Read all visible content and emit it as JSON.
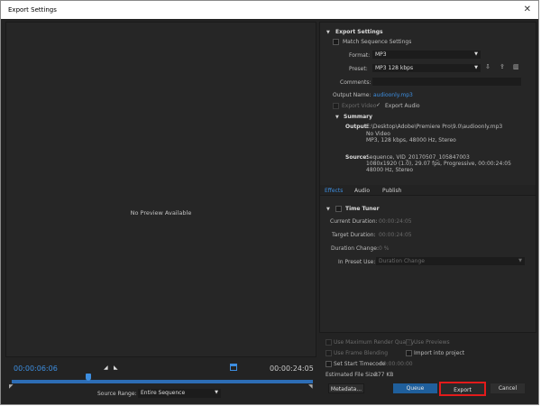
{
  "window": {
    "title": "Export Settings",
    "close_icon": "close-icon"
  },
  "preview": {
    "no_preview_text": "No Preview Available",
    "current_time": "00:00:06:06",
    "end_time": "00:00:24:05",
    "source_range_label": "Source Range:",
    "source_range_value": "Entire Sequence"
  },
  "export_settings": {
    "header": "Export Settings",
    "match_sequence_label": "Match Sequence Settings",
    "format_label": "Format:",
    "format_value": "MP3",
    "preset_label": "Preset:",
    "preset_value": "MP3 128 kbps",
    "comments_label": "Comments:",
    "output_name_label": "Output Name:",
    "output_name_value": "audioonly.mp3",
    "export_video_label": "Export Video",
    "export_audio_label": "Export Audio",
    "export_audio_check": "✓"
  },
  "summary": {
    "header": "Summary",
    "output_label": "Output:",
    "output_lines": [
      "E:\\Desktop\\Adobe\\Premiere Pro\\9.0\\audioonly.mp3",
      "No Video",
      "MP3, 128 kbps, 48000 Hz, Stereo"
    ],
    "source_label": "Source:",
    "source_lines": [
      "Sequence, VID_20170507_105847003",
      "1080x1920 (1.0), 29.07 fps, Progressive, 00:00:24:05",
      "48000 Hz, Stereo"
    ]
  },
  "tabs": [
    {
      "label": "Effects"
    },
    {
      "label": "Audio"
    },
    {
      "label": "Publish"
    }
  ],
  "time_tuner": {
    "header": "Time Tuner",
    "current_duration_label": "Current Duration:",
    "current_duration_value": "00:00:24:05",
    "target_duration_label": "Target Duration:",
    "target_duration_value": "00:00:24:05",
    "duration_change_label": "Duration Change:",
    "duration_change_value": "0 %",
    "in_preset_use_label": "In Preset Use:",
    "in_preset_use_value": "Duration Change"
  },
  "bottom": {
    "use_max_render_quality": "Use Maximum Render Quality",
    "use_previews": "Use Previews",
    "use_frame_blending": "Use Frame Blending",
    "import_into_project": "Import into project",
    "set_start_timecode": "Set Start Timecode",
    "start_timecode_value": "00:00:00:00",
    "estimated_file_size_label": "Estimated File Size:",
    "estimated_file_size_value": "377 KB",
    "metadata_button": "Metadata...",
    "queue_button": "Queue",
    "export_button": "Export",
    "cancel_button": "Cancel"
  },
  "colors": {
    "accent": "#3d8ee0",
    "highlight_box": "#e31b1b",
    "queue_button": "#1f5f9c"
  }
}
